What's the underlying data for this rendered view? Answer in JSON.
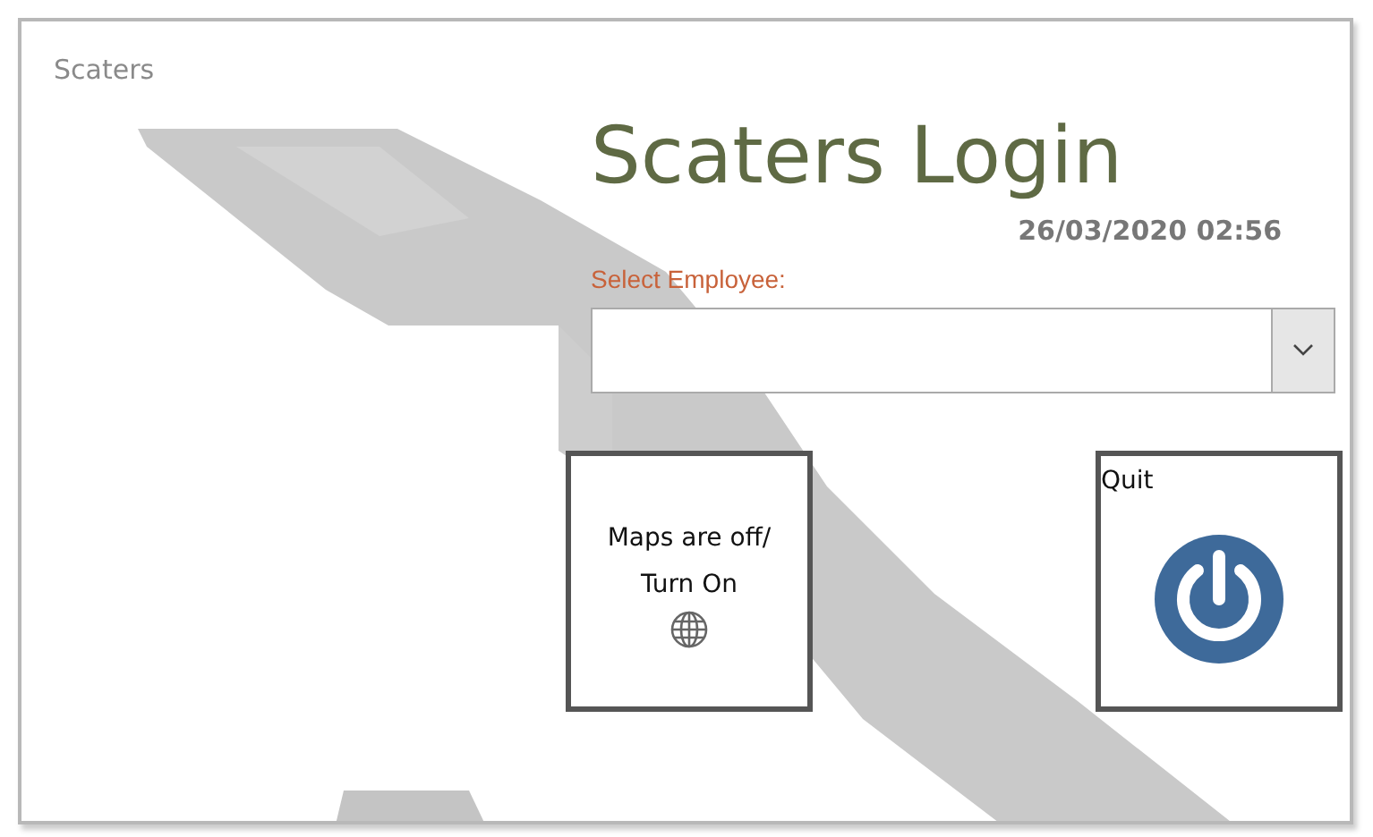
{
  "window": {
    "title": "Scaters"
  },
  "heading": "Scaters Login",
  "datetime": "26/03/2020 02:56",
  "employee_select": {
    "label": "Select Employee:"
  },
  "buttons": [
    {
      "kind": "maps",
      "label": "Maps are off/ Turn On"
    },
    {
      "kind": "quit",
      "label": "Quit"
    }
  ]
}
